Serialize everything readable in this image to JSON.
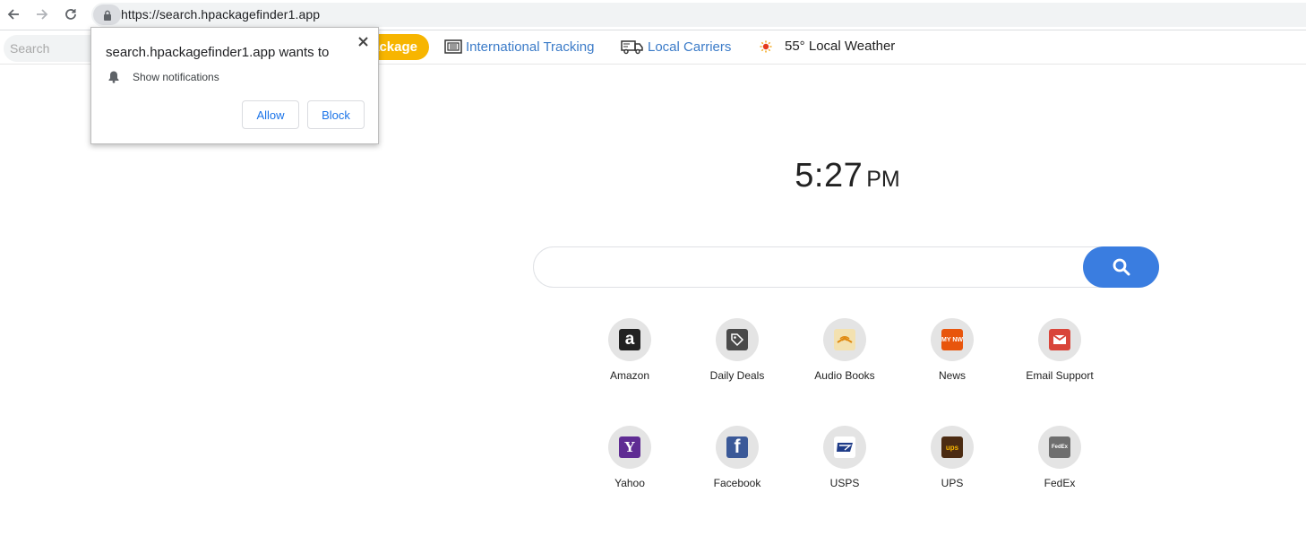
{
  "browser": {
    "url": "https://search.hpackagefinder1.app"
  },
  "toolbar": {
    "search_placeholder": "Search",
    "pill_label": "ackage",
    "links": [
      {
        "label": "International Tracking",
        "icon": "tracking-icon"
      },
      {
        "label": "Local Carriers",
        "icon": "truck-icon"
      }
    ],
    "weather": {
      "label": "55° Local Weather",
      "icon": "weather-sun-icon"
    }
  },
  "popup": {
    "title": "search.hpackagefinder1.app wants to",
    "description": "Show notifications",
    "allow_label": "Allow",
    "block_label": "Block"
  },
  "clock": {
    "time": "5:27",
    "ampm": "PM"
  },
  "search": {
    "value": "",
    "button_icon": "search-icon"
  },
  "tiles": [
    {
      "label": "Amazon",
      "icon": "amazon-icon",
      "color": "#222222"
    },
    {
      "label": "Daily Deals",
      "icon": "tag-icon",
      "color": "#4a4a4a"
    },
    {
      "label": "Audio Books",
      "icon": "audible-icon",
      "color": "#f3e1b0"
    },
    {
      "label": "News",
      "icon": "news-icon",
      "color": "#e8550c"
    },
    {
      "label": "Email Support",
      "icon": "gmail-icon",
      "color": "#d9453a"
    },
    {
      "label": "Yahoo",
      "icon": "yahoo-icon",
      "color": "#5f2c93"
    },
    {
      "label": "Facebook",
      "icon": "facebook-icon",
      "color": "#3b5998"
    },
    {
      "label": "USPS",
      "icon": "usps-icon",
      "color": "#ffffff"
    },
    {
      "label": "UPS",
      "icon": "ups-icon",
      "color": "#4b2b12"
    },
    {
      "label": "FedEx",
      "icon": "fedex-icon",
      "color": "#6e6e6e"
    }
  ],
  "tile_glyphs": {
    "amazon": "a",
    "yahoo": "Y",
    "facebook": "f",
    "news": "MY NW",
    "ups": "ups",
    "fedex": "FedEx"
  }
}
